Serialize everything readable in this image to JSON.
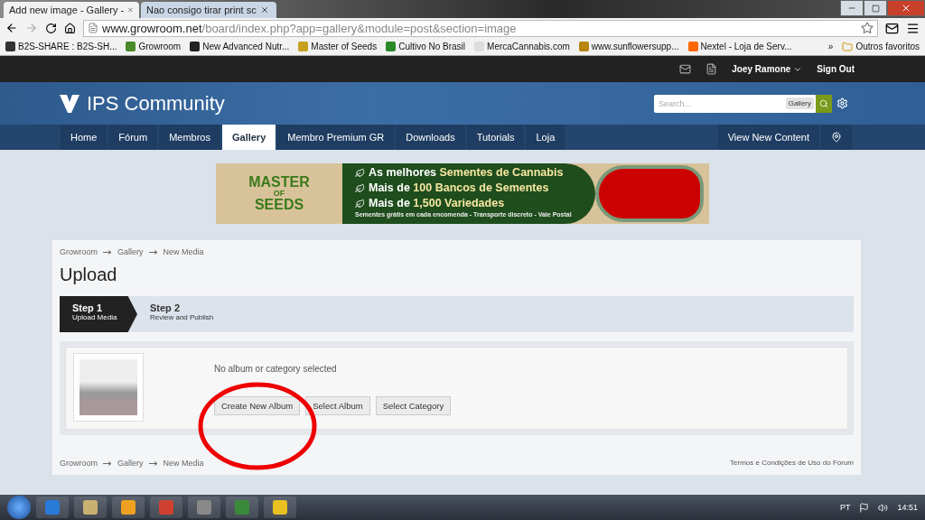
{
  "browser": {
    "tabs": [
      {
        "title": "Add new image - Gallery -",
        "selected": true
      },
      {
        "title": "Nao consigo tirar print sc",
        "selected": false
      }
    ],
    "address": {
      "host": "www.growroom.net",
      "path": "/board/index.php?app=gallery&module=post&section=image"
    },
    "bookmarks": [
      "B2S-SHARE : B2S-SH...",
      "Growroom",
      "New Advanced Nutr...",
      "Master of Seeds",
      "Cultivo No Brasil",
      "MercaCannabis.com",
      "www.sunflowersupp...",
      "Nextel - Loja de Serv..."
    ],
    "bookmarks_more": "»",
    "other_bookmarks": "Outros favoritos"
  },
  "site": {
    "user": "Joey Ramone",
    "sign_out": "Sign Out",
    "logo": "IPS Community",
    "search": {
      "placeholder": "Search...",
      "scope": "Gallery"
    },
    "nav": [
      {
        "label": "Home",
        "selected": false
      },
      {
        "label": "Fórum",
        "selected": false
      },
      {
        "label": "Membros",
        "selected": false
      },
      {
        "label": "Gallery",
        "selected": true
      },
      {
        "label": "Membro Premium GR",
        "selected": false
      },
      {
        "label": "Downloads",
        "selected": false
      },
      {
        "label": "Tutorials",
        "selected": false
      },
      {
        "label": "Loja",
        "selected": false
      }
    ],
    "nav_right": "View New Content"
  },
  "banner": {
    "logo": [
      "MASTER",
      "OF",
      "SEEDS"
    ],
    "lines": [
      {
        "lead": "As melhores",
        "highlight": "Sementes de Cannabis"
      },
      {
        "lead": "Mais de",
        "highlight": "100 Bancos de Sementes"
      },
      {
        "lead": "Mais de",
        "highlight": "1,500 Variedades"
      }
    ],
    "footer": "Sementes grátis em cada encomenda - Transporte discreto - Vale Postal"
  },
  "page": {
    "breadcrumb": [
      "Growroom",
      "Gallery",
      "New Media"
    ],
    "title": "Upload",
    "steps": [
      {
        "title": "Step 1",
        "subtitle": "Upload Media",
        "selected": true
      },
      {
        "title": "Step 2",
        "subtitle": "Review and Publish",
        "selected": false
      }
    ],
    "message": "No album or category selected",
    "buttons": [
      "Create New Album",
      "Select Album",
      "Select Category"
    ],
    "footer_breadcrumb": [
      "Growroom",
      "Gallery",
      "New Media"
    ],
    "footer_link": "Termos e Condições de Uso do Fórum"
  },
  "taskbar": {
    "language": "PT",
    "time": "14:51"
  }
}
